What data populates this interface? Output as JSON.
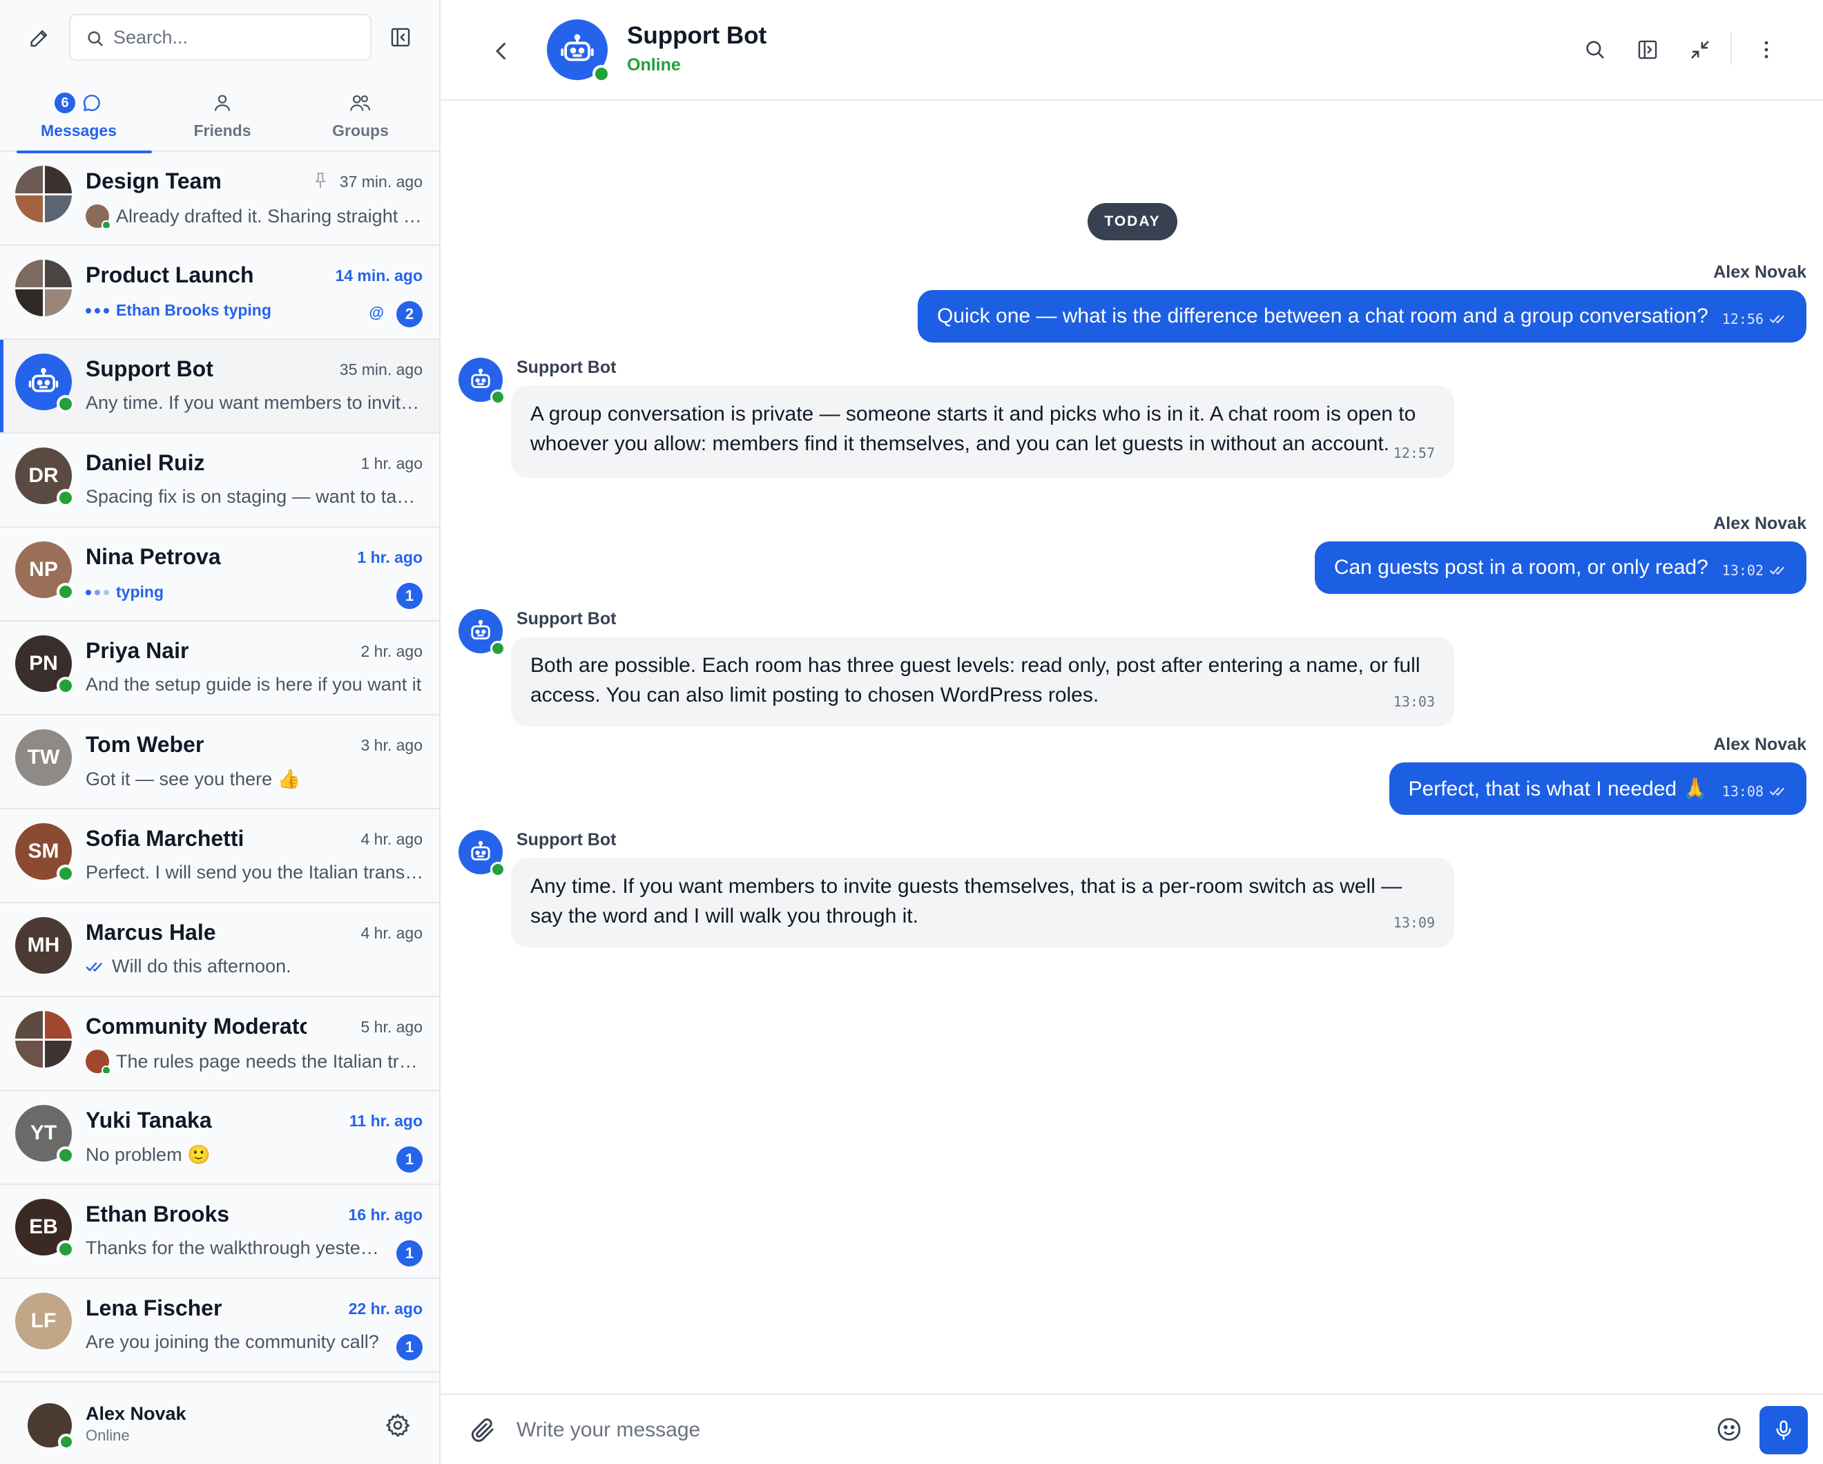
{
  "sidebar": {
    "search_placeholder": "Search...",
    "tabs": [
      {
        "label": "Messages",
        "badge": "6",
        "active": true
      },
      {
        "label": "Friends"
      },
      {
        "label": "Groups"
      }
    ],
    "conversations": [
      {
        "name": "Design Team",
        "time": "37 min. ago",
        "preview": "Already drafted it. Sharing straight after lunch.",
        "pinned": true
      },
      {
        "name": "Product Launch",
        "time": "14 min. ago",
        "preview": "Ethan Brooks typing",
        "mention": "@",
        "count": "2"
      },
      {
        "name": "Support Bot",
        "time": "35 min. ago",
        "preview": "Any time. If you want members to invite guests themselves",
        "active": true
      },
      {
        "name": "Daniel Ruiz",
        "time": "1 hr. ago",
        "preview": "Spacing fix is on staging — want to take a look?"
      },
      {
        "name": "Nina Petrova",
        "time": "1 hr. ago",
        "preview": "typing",
        "count": "1"
      },
      {
        "name": "Priya Nair",
        "time": "2 hr. ago",
        "preview": "And the setup guide is here if you want it"
      },
      {
        "name": "Tom Weber",
        "time": "3 hr. ago",
        "preview": "Got it — see you there 👍"
      },
      {
        "name": "Sofia Marchetti",
        "time": "4 hr. ago",
        "preview": "Perfect. I will send you the Italian translation"
      },
      {
        "name": "Marcus Hale",
        "time": "4 hr. ago",
        "preview": "Will do this afternoon."
      },
      {
        "name": "Community Moderators",
        "time": "5 hr. ago",
        "preview": "The rules page needs the Italian translation"
      },
      {
        "name": "Yuki Tanaka",
        "time": "11 hr. ago",
        "preview": "No problem 🙂",
        "count": "1"
      },
      {
        "name": "Ethan Brooks",
        "time": "16 hr. ago",
        "preview": "Thanks for the walkthrough yesterday",
        "count": "1"
      },
      {
        "name": "Lena Fischer",
        "time": "22 hr. ago",
        "preview": "Are you joining the community call?",
        "count": "1"
      }
    ],
    "me": {
      "name": "Alex Novak",
      "status": "Online"
    }
  },
  "header": {
    "name": "Support Bot",
    "status": "Online"
  },
  "chat": {
    "day_label": "TODAY",
    "messages": [
      {
        "from": "Alex Novak",
        "text": "Quick one — what is the difference between a chat room and a group conversation?",
        "time": "12:56"
      },
      {
        "from": "Support Bot",
        "text": "A group conversation is private — someone starts it and picks who is in it. A chat room is open to whoever you allow: members find it themselves, and you can let guests in without an account.",
        "time": "12:57"
      },
      {
        "from": "Alex Novak",
        "text": "Can guests post in a room, or only read?",
        "time": "13:02"
      },
      {
        "from": "Support Bot",
        "text": "Both are possible. Each room has three guest levels: read only, post after entering a name, or full access. You can also limit posting to chosen WordPress roles.",
        "time": "13:03"
      },
      {
        "from": "Alex Novak",
        "text": "Perfect, that is what I needed 🙏",
        "time": "13:08"
      },
      {
        "from": "Support Bot",
        "text": "Any time. If you want members to invite guests themselves, that is a per-room switch as well — say the word and I will walk you through it.",
        "time": "13:09"
      }
    ]
  },
  "composer": {
    "placeholder": "Write your message"
  },
  "colors": {
    "accent": "#1d5fe3",
    "online": "#22a03a",
    "typing": "#2563eb"
  }
}
